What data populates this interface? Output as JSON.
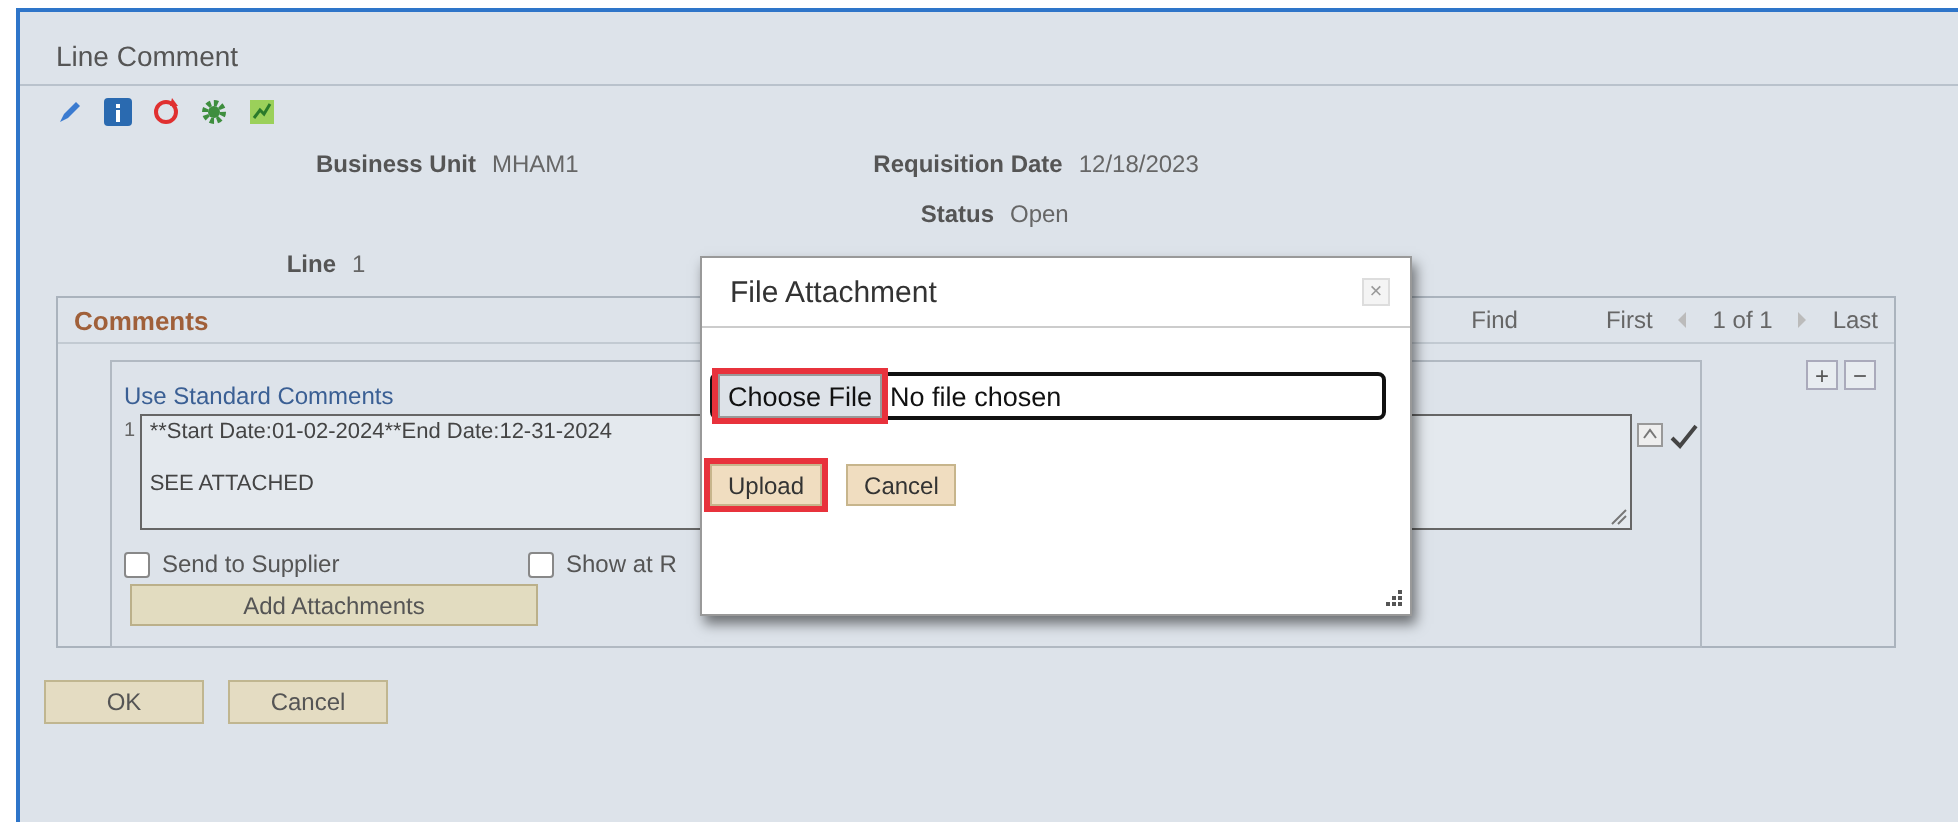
{
  "window": {
    "title": "Line Comment"
  },
  "fields": [
    {
      "label": "Business Unit",
      "value": "MHAM1"
    },
    {
      "label": "Requisition Date",
      "value": "12/18/2023"
    },
    {
      "label": "Status",
      "value": "Open"
    },
    {
      "label": "Line",
      "value": "1"
    }
  ],
  "comments": {
    "title": "Comments",
    "find": "Find",
    "first": "First",
    "count": "1 of 1",
    "last": "Last",
    "add": "+",
    "remove": "−",
    "standard_link": "Use Standard Comments",
    "row_number": "1",
    "text_lines": [
      "**Start Date:01-02-2024**End Date:12-31-2024",
      "SEE ATTACHED"
    ],
    "checkboxes": [
      {
        "label": "Send to Supplier",
        "checked": false
      },
      {
        "label": "Show at R",
        "checked": false
      }
    ],
    "attach_button": "Add Attachments"
  },
  "buttons": [
    "OK",
    "Cancel"
  ],
  "dialog": {
    "title": "File Attachment",
    "close": "×",
    "choose_button": {
      "label": "Choose File",
      "highlighted": true
    },
    "file_status": "No file chosen",
    "buttons": [
      {
        "label": "Upload",
        "highlighted": true
      },
      {
        "label": "Cancel",
        "highlighted": false
      }
    ]
  }
}
